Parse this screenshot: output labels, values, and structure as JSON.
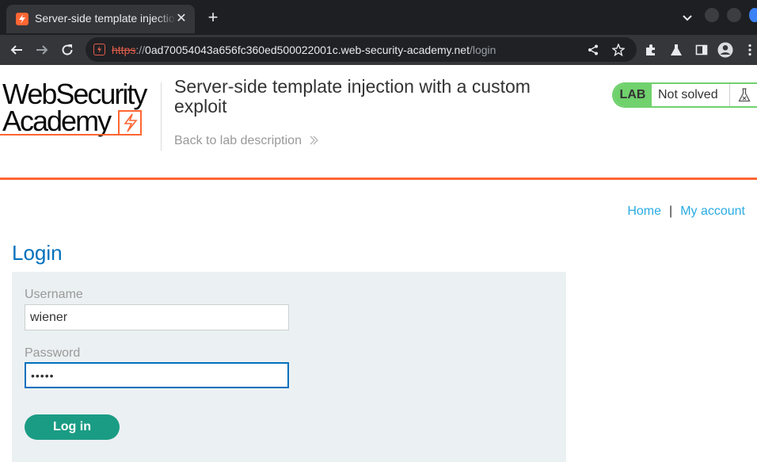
{
  "browser": {
    "tab": {
      "title": "Server-side template injection with a custom exploit",
      "favicon": "flame-icon"
    },
    "address": {
      "scheme": "https",
      "separator": "://",
      "host": "0ad70054043a656fc360ed500022001c.web-security-academy.net",
      "path": "/login"
    }
  },
  "header": {
    "logo": {
      "line1": "WebSecurity",
      "line2": "Academy"
    },
    "lab_title": "Server-side template injection with a custom exploit",
    "back_link": "Back to lab description",
    "status": {
      "badge": "LAB",
      "text": "Not solved",
      "icon": "flask-icon"
    }
  },
  "nav": {
    "home": "Home",
    "separator": "|",
    "account": "My account"
  },
  "login": {
    "heading": "Login",
    "username_label": "Username",
    "username_value": "wiener",
    "password_label": "Password",
    "password_value": "•••••",
    "submit": "Log in"
  },
  "colors": {
    "brand_orange": "#ff6633",
    "link_blue": "#29abe2",
    "heading_blue": "#0071bc",
    "solved_green": "#70d16d",
    "button_green": "#1a9c84",
    "panel": "#ebf0f2"
  }
}
